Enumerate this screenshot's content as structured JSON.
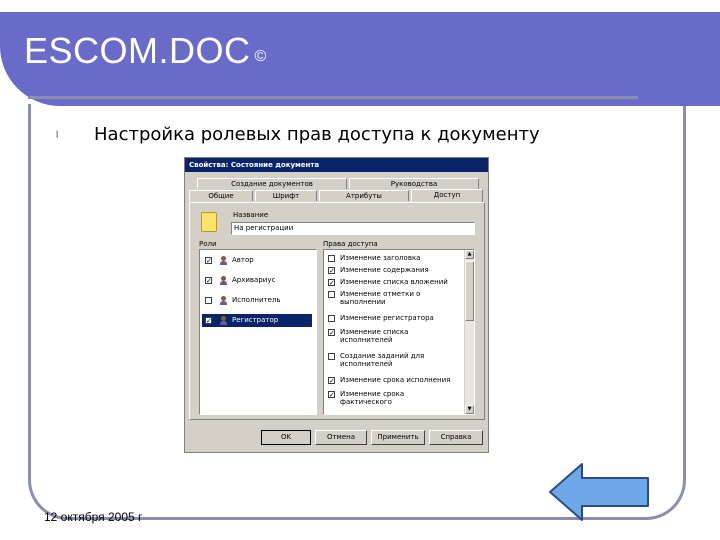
{
  "slide": {
    "title": "ESCOM.DOC",
    "copyright_mark": "©",
    "bullet": "l",
    "heading": "Настройка ролевых прав доступа к документу",
    "date": "12 октября 2005 г"
  },
  "dialog": {
    "title": "Свойства: Состояние документа",
    "tabs_back": [
      "Создание документов",
      "Руководства"
    ],
    "tabs_front": [
      "Общие",
      "Шрифт",
      "Атрибуты",
      "Доступ"
    ],
    "name_label": "Название",
    "name_value": "На регистрации",
    "roles_label": "Роли",
    "rights_label": "Права доступа",
    "roles": [
      {
        "label": "Автор",
        "checked": true,
        "selected": false
      },
      {
        "label": "Архивариус",
        "checked": true,
        "selected": false
      },
      {
        "label": "Исполнитель",
        "checked": false,
        "selected": false
      },
      {
        "label": "Регистратор",
        "checked": true,
        "selected": true
      }
    ],
    "rights": [
      {
        "label": "Изменение заголовка",
        "checked": false
      },
      {
        "label": "Изменение содержания",
        "checked": true
      },
      {
        "label": "Изменение списка вложений",
        "checked": true
      },
      {
        "label": "Изменение отметки о выполнении",
        "checked": false
      },
      {
        "label": "Изменение регистратора",
        "checked": false
      },
      {
        "label": "Изменение списка исполнителей",
        "checked": true
      },
      {
        "label": "Создание заданий для исполнителей",
        "checked": false
      },
      {
        "label": "Изменение срока исполнения",
        "checked": true
      },
      {
        "label": "Изменение срока фактического",
        "checked": true
      }
    ],
    "buttons": {
      "ok": "OK",
      "cancel": "Отмена",
      "apply": "Применить",
      "help": "Справка"
    }
  },
  "icons": {
    "nav": "back-arrow-icon",
    "document": "document-icon",
    "person": "person-icon"
  },
  "colors": {
    "header": "#6a6bc9",
    "frame": "#8a8fae",
    "dialog_title": "#0a246a",
    "arrow": "#6fa8e8"
  }
}
